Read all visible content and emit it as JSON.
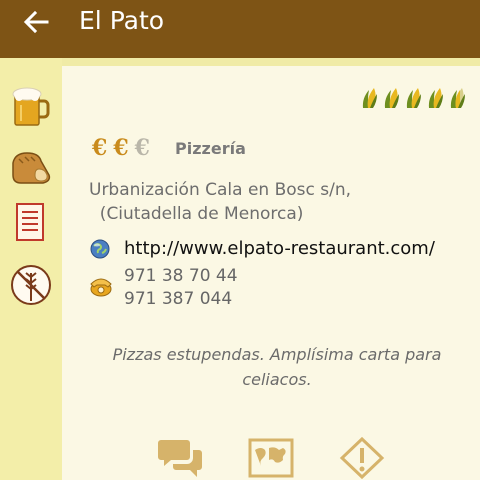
{
  "appbar": {
    "title": "El Pato",
    "back_icon": "arrow-left-icon"
  },
  "sidebar": {
    "items": [
      {
        "name": "beer",
        "icon": "beer-mug-icon"
      },
      {
        "name": "bread",
        "icon": "bread-icon"
      },
      {
        "name": "menu",
        "icon": "menu-list-icon"
      },
      {
        "name": "gluten-free",
        "icon": "gluten-free-icon"
      }
    ]
  },
  "restaurant": {
    "rating": {
      "value": 4.5,
      "max": 5,
      "icon": "corn-cob-icon"
    },
    "price": {
      "symbol": "€",
      "level": 2,
      "max": 3
    },
    "category": "Pizzería",
    "address": "Urbanización Cala en Bosc s/n,\n  (Ciutadella de Menorca)",
    "website": "http://www.elpato-restaurant.com/",
    "phones": [
      "971 38 70 44",
      "971 387 044"
    ],
    "description": "Pizzas estupendas. Amplísima carta para celiacos."
  },
  "actions": [
    {
      "name": "comments",
      "icon": "chat-bubbles-icon"
    },
    {
      "name": "map",
      "icon": "map-icon"
    },
    {
      "name": "report",
      "icon": "warning-icon"
    }
  ],
  "colors": {
    "appbar": "#7e5415",
    "background": "#f0eba6",
    "card": "#fbf8e4",
    "accent": "#c98b1c"
  }
}
